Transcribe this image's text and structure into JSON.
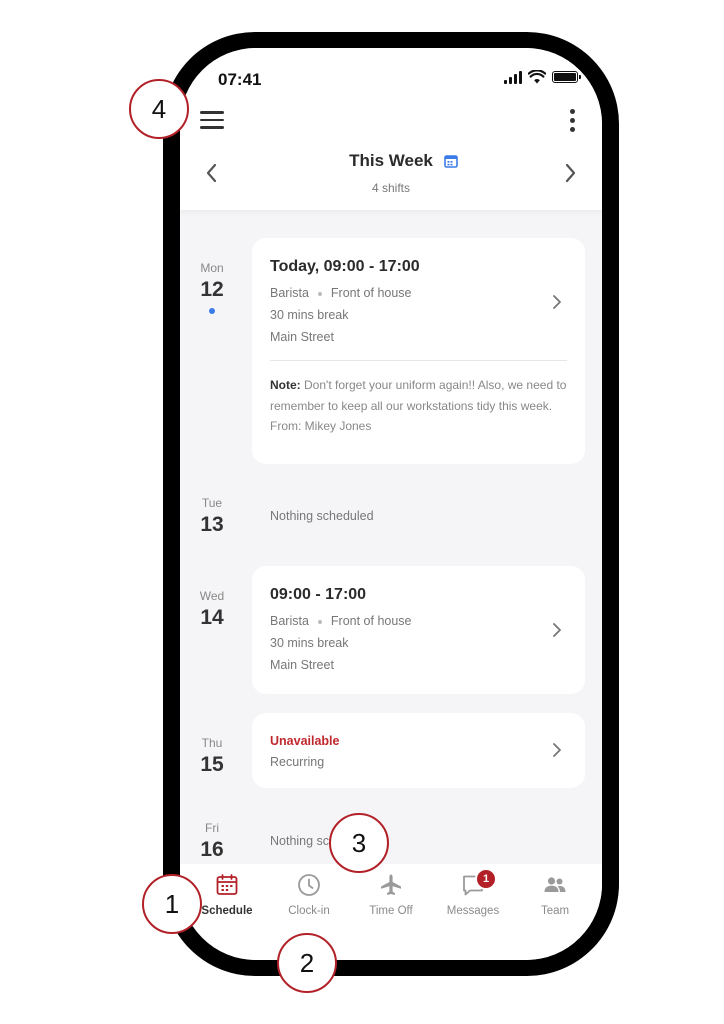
{
  "status_bar": {
    "time": "07:41"
  },
  "header": {
    "week_title": "This Week",
    "shift_count": "4 shifts"
  },
  "days": [
    {
      "day_name": "Mon",
      "day_num": "12",
      "is_today": true,
      "shift": {
        "title": "Today, 09:00 - 17:00",
        "role": "Barista",
        "area": "Front of house",
        "break": "30 mins break",
        "location": "Main Street",
        "note_label": "Note:",
        "note": "Don't forget your uniform again!! Also, we need to remember to keep all our workstations tidy this week. From: Mikey Jones"
      }
    },
    {
      "day_name": "Tue",
      "day_num": "13",
      "empty_text": "Nothing scheduled"
    },
    {
      "day_name": "Wed",
      "day_num": "14",
      "shift": {
        "title": "09:00 - 17:00",
        "role": "Barista",
        "area": "Front of house",
        "break": "30 mins break",
        "location": "Main Street"
      }
    },
    {
      "day_name": "Thu",
      "day_num": "15",
      "unavailability": {
        "status": "Unavailable",
        "recurrence": "Recurring"
      }
    },
    {
      "day_name": "Fri",
      "day_num": "16",
      "empty_text": "Nothing scheduled"
    }
  ],
  "tab_bar": {
    "tabs": [
      {
        "label": "Schedule",
        "icon": "calendar-icon",
        "active": true
      },
      {
        "label": "Clock-in",
        "icon": "clock-icon"
      },
      {
        "label": "Time Off",
        "icon": "airplane-icon"
      },
      {
        "label": "Messages",
        "icon": "chat-bubble-icon",
        "badge": "1"
      },
      {
        "label": "Team",
        "icon": "people-icon"
      }
    ]
  },
  "callouts": [
    "1",
    "2",
    "3",
    "4"
  ],
  "colors": {
    "accent_red": "#b22128",
    "today_dot": "#3b7be8",
    "calendar_icon": "#3b7be8"
  }
}
